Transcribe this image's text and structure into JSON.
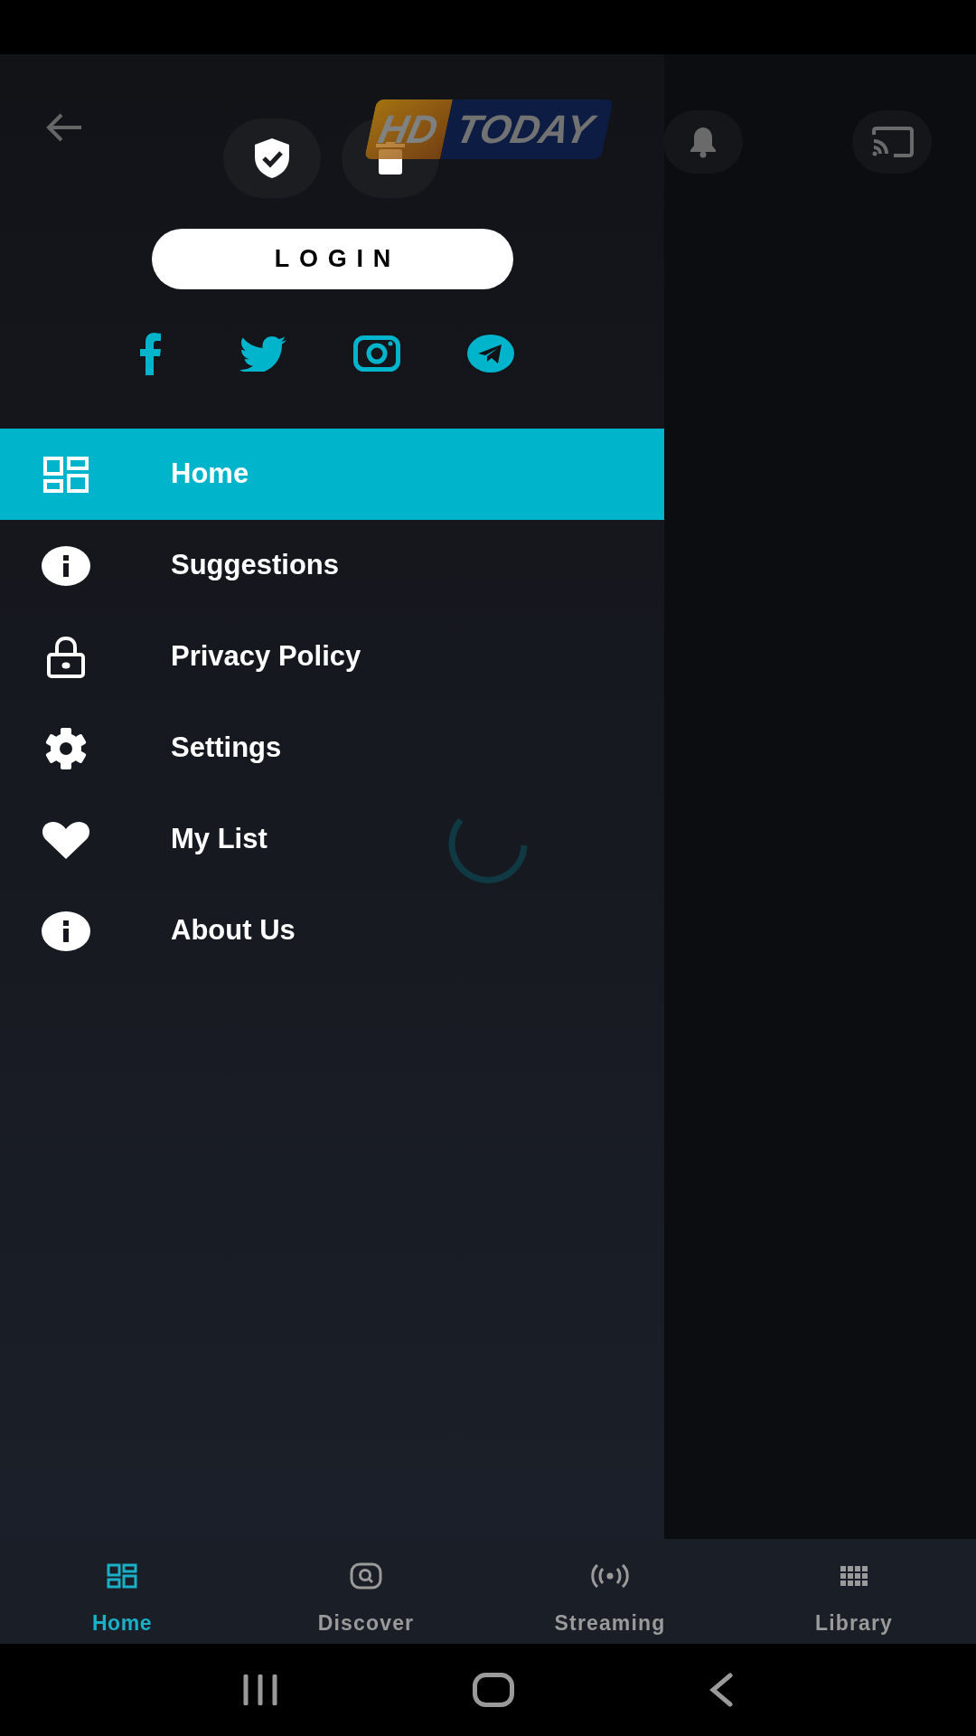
{
  "header": {
    "logo": [
      "HD",
      "TODAY"
    ]
  },
  "drawer": {
    "login_button": "LOGIN",
    "menu": [
      {
        "label": "Home",
        "selected": true
      },
      {
        "label": "Suggestions",
        "selected": false
      },
      {
        "label": "Privacy Policy",
        "selected": false
      },
      {
        "label": "Settings",
        "selected": false
      },
      {
        "label": "My List",
        "selected": false
      },
      {
        "label": "About Us",
        "selected": false
      }
    ]
  },
  "bottom_nav": [
    {
      "label": "Home",
      "selected": true
    },
    {
      "label": "Discover",
      "selected": false
    },
    {
      "label": "Streaming",
      "selected": false
    },
    {
      "label": "Library",
      "selected": false
    }
  ]
}
